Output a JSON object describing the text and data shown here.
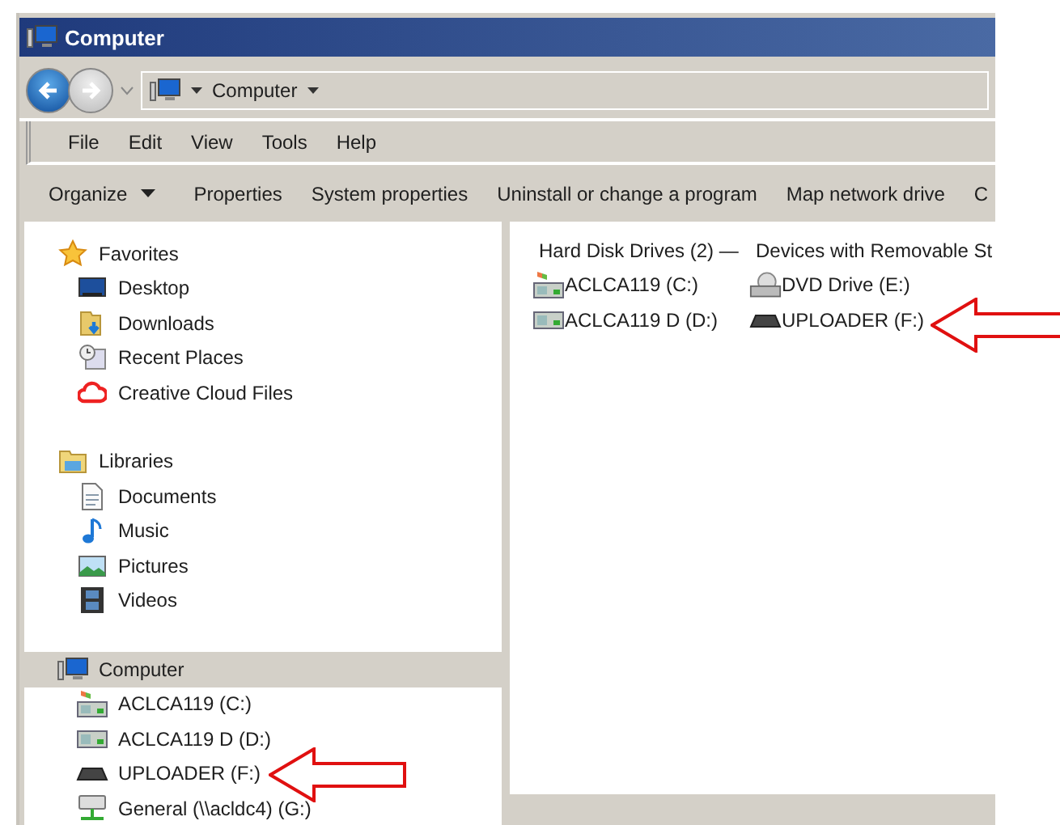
{
  "window": {
    "title": "Computer"
  },
  "address": {
    "path": "Computer"
  },
  "menu": [
    "File",
    "Edit",
    "View",
    "Tools",
    "Help"
  ],
  "toolbar": [
    {
      "label": "Organize",
      "dropdown": true
    },
    {
      "label": "Properties",
      "dropdown": false
    },
    {
      "label": "System properties",
      "dropdown": false
    },
    {
      "label": "Uninstall or change a program",
      "dropdown": false
    },
    {
      "label": "Map network drive",
      "dropdown": false
    },
    {
      "label": "C",
      "dropdown": false
    }
  ],
  "navigation": [
    {
      "label": "Favorites",
      "kind": "star",
      "selected": false,
      "children": [
        {
          "label": "Desktop",
          "kind": "desktop",
          "selected": false
        },
        {
          "label": "Downloads",
          "kind": "downloads",
          "selected": false
        },
        {
          "label": "Recent Places",
          "kind": "recent",
          "selected": false
        },
        {
          "label": "Creative Cloud Files",
          "kind": "cloud",
          "selected": false
        }
      ]
    },
    {
      "label": "Libraries",
      "kind": "library",
      "selected": false,
      "children": [
        {
          "label": "Documents",
          "kind": "document",
          "selected": false
        },
        {
          "label": "Music",
          "kind": "music",
          "selected": false
        },
        {
          "label": "Pictures",
          "kind": "picture",
          "selected": false
        },
        {
          "label": "Videos",
          "kind": "video",
          "selected": false
        }
      ]
    },
    {
      "label": "Computer",
      "kind": "computer",
      "selected": true,
      "children": [
        {
          "label": "ACLCA119 (C:)",
          "kind": "system-disk",
          "selected": false
        },
        {
          "label": "ACLCA119 D (D:)",
          "kind": "disk",
          "selected": false
        },
        {
          "label": "UPLOADER (F:)",
          "kind": "removable",
          "selected": false
        },
        {
          "label": "General (\\\\acldc4) (G:)",
          "kind": "network",
          "selected": false
        }
      ]
    }
  ],
  "drive_groups": [
    {
      "heading": "Hard Disk Drives (2) —",
      "drives": [
        {
          "label": "ACLCA119 (C:)",
          "kind": "system-disk"
        },
        {
          "label": "ACLCA119 D (D:)",
          "kind": "disk"
        }
      ]
    },
    {
      "heading": "Devices with Removable St",
      "drives": [
        {
          "label": "DVD Drive (E:)",
          "kind": "dvd"
        },
        {
          "label": "UPLOADER (F:)",
          "kind": "removable"
        }
      ]
    }
  ]
}
